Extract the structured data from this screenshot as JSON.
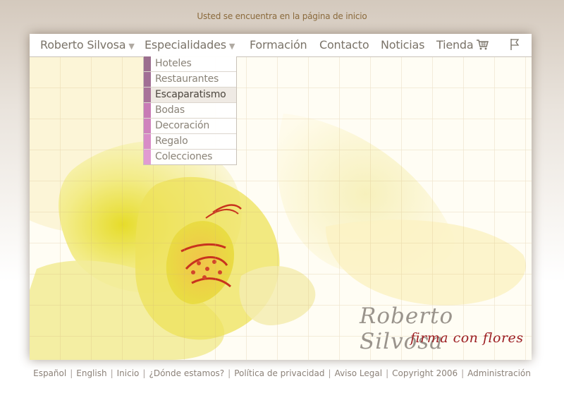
{
  "breadcrumb": "Usted se encuentra en la página de inicio",
  "nav": {
    "items": [
      {
        "label": "Roberto Silvosa",
        "dropdown": true
      },
      {
        "label": "Especialidades",
        "dropdown": true
      },
      {
        "label": "Formación"
      },
      {
        "label": "Contacto"
      },
      {
        "label": "Noticias"
      },
      {
        "label": "Tienda",
        "icon": "cart-icon"
      }
    ],
    "flag_icon": "flag-icon"
  },
  "submenu": {
    "items": [
      {
        "label": "Hoteles",
        "color": "#9b6e8e"
      },
      {
        "label": "Restaurantes",
        "color": "#a16f95"
      },
      {
        "label": "Escaparatismo",
        "color": "#a87399",
        "active": true
      },
      {
        "label": "Bodas",
        "color": "#c87bb5"
      },
      {
        "label": "Decoración",
        "color": "#cf83bd"
      },
      {
        "label": "Regalo",
        "color": "#d88cc7"
      },
      {
        "label": "Colecciones",
        "color": "#e19bd2"
      }
    ]
  },
  "hero": {
    "brand_name": "Roberto Silvosa",
    "tagline": "firma con flores"
  },
  "footer": {
    "links": [
      "Español",
      "English",
      "Inicio",
      "¿Dónde estamos?",
      "Política de privacidad",
      "Aviso Legal",
      "Copyright 2006",
      "Administración"
    ]
  },
  "colors": {
    "accent_text": "#8a6a3c",
    "tagline": "#9c1d22"
  }
}
